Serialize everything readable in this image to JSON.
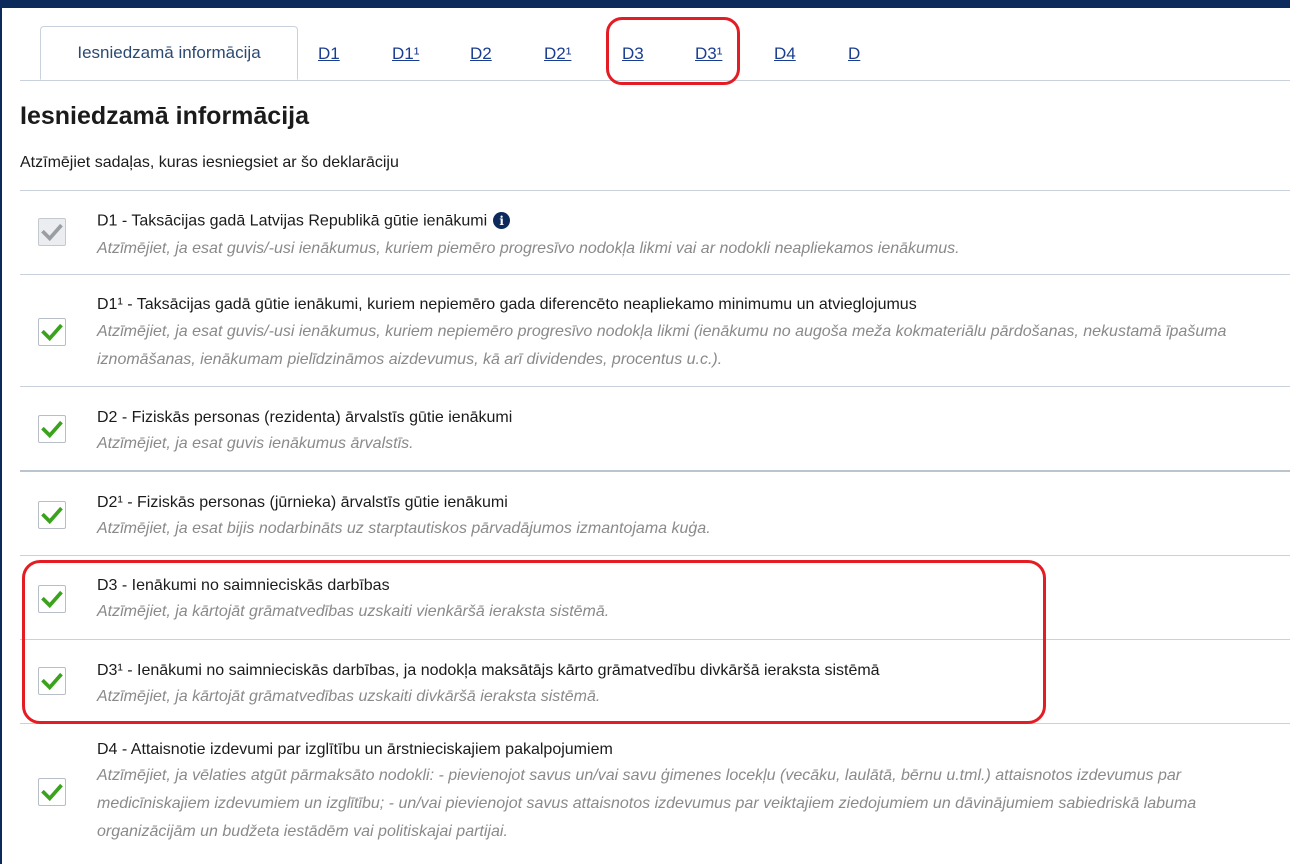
{
  "tabs": {
    "active": "Iesniedzamā informācija",
    "links": [
      "D1",
      "D1¹",
      "D2",
      "D2¹",
      "D3",
      "D3¹",
      "D4",
      "D"
    ]
  },
  "page": {
    "title": "Iesniedzamā informācija",
    "subtitle": "Atzīmējiet sadaļas, kuras iesniegsiet ar šo deklarāciju"
  },
  "sections": [
    {
      "title": "D1 - Taksācijas gadā Latvijas Republikā gūtie ienākumi",
      "description": "Atzīmējiet, ja esat guvis/-usi ienākumus, kuriem piemēro progresīvo nodokļa likmi vai ar nodokli neapliekamos ienākumus.",
      "checked": true,
      "disabled": true,
      "info_icon": "info-circle-icon"
    },
    {
      "title": "D1¹ - Taksācijas gadā gūtie ienākumi, kuriem nepiemēro gada diferencēto neapliekamo minimumu un atvieglojumus",
      "description": "Atzīmējiet, ja esat guvis/-usi ienākumus, kuriem nepiemēro progresīvo nodokļa likmi (ienākumu no augoša meža kokmateriālu pārdošanas, nekustamā īpašuma iznomāšanas, ienākumam pielīdzināmos aizdevumus, kā arī dividendes, procentus u.c.).",
      "checked": true,
      "disabled": false
    },
    {
      "title": "D2 - Fiziskās personas (rezidenta) ārvalstīs gūtie ienākumi",
      "description": "Atzīmējiet, ja esat guvis ienākumus ārvalstīs.",
      "checked": true,
      "disabled": false
    },
    {
      "title": "D2¹ - Fiziskās personas (jūrnieka) ārvalstīs gūtie ienākumi",
      "description": "Atzīmējiet, ja esat bijis nodarbināts uz starptautiskos pārvadājumos izmantojama kuģa.",
      "checked": true,
      "disabled": false
    },
    {
      "title": "D3 - Ienākumi no saimnieciskās darbības",
      "description": "Atzīmējiet, ja kārtojāt grāmatvedības uzskaiti vienkāršā ieraksta sistēmā.",
      "checked": true,
      "disabled": false
    },
    {
      "title": "D3¹ - Ienākumi no saimnieciskās darbības, ja nodokļa maksātājs kārto grāmatvedību divkāršā ieraksta sistēmā",
      "description": "Atzīmējiet, ja kārtojāt grāmatvedības uzskaiti divkāršā ieraksta sistēmā.",
      "checked": true,
      "disabled": false
    },
    {
      "title": "D4 - Attaisnotie izdevumi par izglītību un ārstnieciskajiem pakalpojumiem",
      "description": "Atzīmējiet, ja vēlaties atgūt pārmaksāto nodokli: - pievienojot savus un/vai savu ģimenes locekļu (vecāku, laulātā, bērnu u.tml.) attaisnotos izdevumus par medicīniskajiem izdevumiem un izglītību; - un/vai pievienojot savus attaisnotos izdevumus par veiktajiem ziedojumiem un dāvinājumiem sabiedriskā labuma organizācijām un budžeta iestādēm vai politiskajai partijai.",
      "checked": true,
      "disabled": false
    }
  ],
  "colors": {
    "check_green": "#3aa21c",
    "check_disabled": "#9a9ea3",
    "highlight_red": "#e31d23",
    "header_navy": "#0d2a5c",
    "link_blue": "#1b3d8f"
  }
}
